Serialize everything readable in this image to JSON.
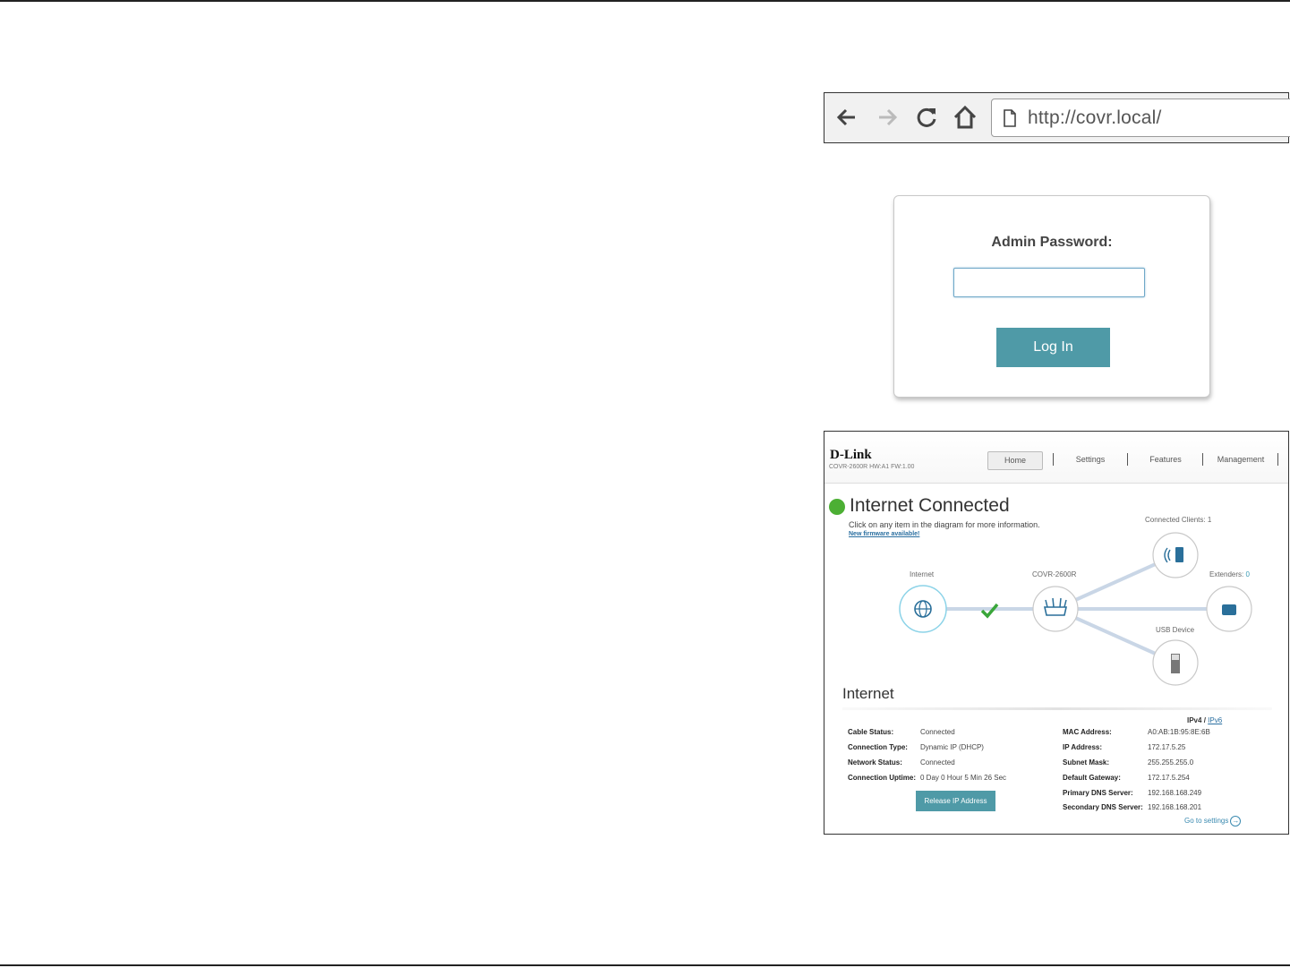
{
  "browser": {
    "url": "http://covr.local/",
    "icons": [
      "back-arrow-icon",
      "forward-arrow-icon",
      "reload-icon",
      "home-icon",
      "page-icon"
    ]
  },
  "login": {
    "label": "Admin Password:",
    "password_value": "",
    "button": "Log In"
  },
  "router": {
    "brand": "D-Link",
    "model_line": "COVR-2600R HW:A1 FW:1.00",
    "tabs": [
      "Home",
      "Settings",
      "Features",
      "Management"
    ],
    "active_tab": "Home",
    "status": {
      "title": "Internet Connected",
      "hint": "Click on any item in the diagram for more information.",
      "firmware_link": "New firmware available!",
      "color": "#4caf34"
    },
    "diagram": {
      "internet_label": "Internet",
      "router_label": "COVR-2600R",
      "clients_label": "Connected Clients:",
      "clients_count": "1",
      "extenders_label": "Extenders:",
      "extenders_count": "0",
      "usb_label": "USB Device"
    },
    "section_title": "Internet",
    "ipv4": "IPv4",
    "ipv_sep": "/",
    "ipv6": "IPv6",
    "left_info": [
      {
        "key": "Cable Status:",
        "value": "Connected"
      },
      {
        "key": "Connection Type:",
        "value": "Dynamic IP (DHCP)"
      },
      {
        "key": "Network Status:",
        "value": "Connected"
      },
      {
        "key": "Connection Uptime:",
        "value": "0 Day 0 Hour 5 Min 26 Sec"
      }
    ],
    "right_info": [
      {
        "key": "MAC Address:",
        "value": "A0:AB:1B:95:8E:6B"
      },
      {
        "key": "IP Address:",
        "value": "172.17.5.25"
      },
      {
        "key": "Subnet Mask:",
        "value": "255.255.255.0"
      },
      {
        "key": "Default Gateway:",
        "value": "172.17.5.254"
      },
      {
        "key": "Primary DNS Server:",
        "value": "192.168.168.249"
      },
      {
        "key": "Secondary DNS Server:",
        "value": "192.168.168.201"
      }
    ],
    "release_button": "Release IP Address",
    "goto_settings": "Go to settings",
    "accent": "#4f9aa7"
  }
}
